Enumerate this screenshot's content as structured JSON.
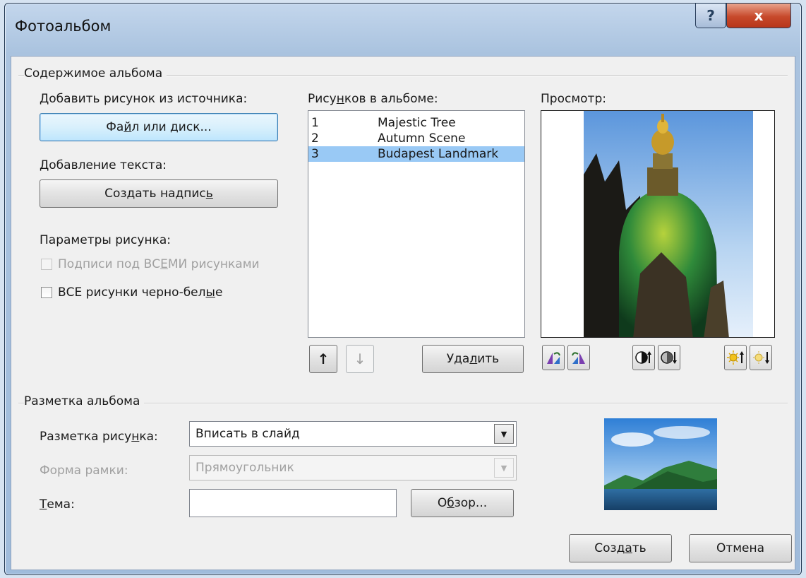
{
  "window": {
    "title": "Фотоальбом",
    "help_label": "?",
    "close_label": "x"
  },
  "content_group": {
    "title": "Содержимое альбома",
    "add_picture_label": "Добавить рисунок из источника:",
    "file_button_pre": "Фа",
    "file_button_ul": "й",
    "file_button_post": "л или диск...",
    "add_text_label": "Добавление текста:",
    "caption_button_pre": "Создать надпис",
    "caption_button_ul": "ь",
    "picture_options_label": "Параметры рисунка:",
    "captions_all_pre": "Подписи под ВС",
    "captions_all_ul": "Е",
    "captions_all_post": "МИ рисунками",
    "captions_all_checked": false,
    "bw_all_pre": "ВСЕ рисунки черно-бел",
    "bw_all_ul": "ы",
    "bw_all_post": "е",
    "bw_all_checked": false
  },
  "pictures": {
    "label_pre": "Рису",
    "label_ul": "н",
    "label_post": "ков в альбоме:",
    "items": [
      {
        "num": "1",
        "name": "Majestic Tree",
        "selected": false
      },
      {
        "num": "2",
        "name": "Autumn Scene",
        "selected": false
      },
      {
        "num": "3",
        "name": "Budapest Landmark",
        "selected": true
      }
    ],
    "move_up_label": "↑",
    "move_down_label": "↓",
    "delete_pre": "Уда",
    "delete_ul": "л",
    "delete_post": "ить"
  },
  "preview": {
    "label": "Просмотр:",
    "tools": [
      "rotate-left-icon",
      "rotate-right-icon",
      "contrast-up-icon",
      "contrast-down-icon",
      "brightness-up-icon",
      "brightness-down-icon"
    ]
  },
  "layout_group": {
    "title": "Разметка альбома",
    "picture_layout_pre": "Разметка рису",
    "picture_layout_ul": "н",
    "picture_layout_post": "ка:",
    "picture_layout_value": "Вписать в слайд",
    "frame_shape_label": "Форма рамки:",
    "frame_shape_value": "Прямоугольник",
    "theme_pre": "",
    "theme_ul": "Т",
    "theme_post": "ема:",
    "theme_value": "",
    "browse_pre": "О",
    "browse_ul": "б",
    "browse_post": "зор..."
  },
  "footer": {
    "create_pre": "Созд",
    "create_ul": "а",
    "create_post": "ть",
    "cancel_label": "Отмена"
  },
  "colors": {
    "selection": "#99c9f5",
    "titlebar": "#aac3df",
    "close_button": "#c7492b"
  }
}
